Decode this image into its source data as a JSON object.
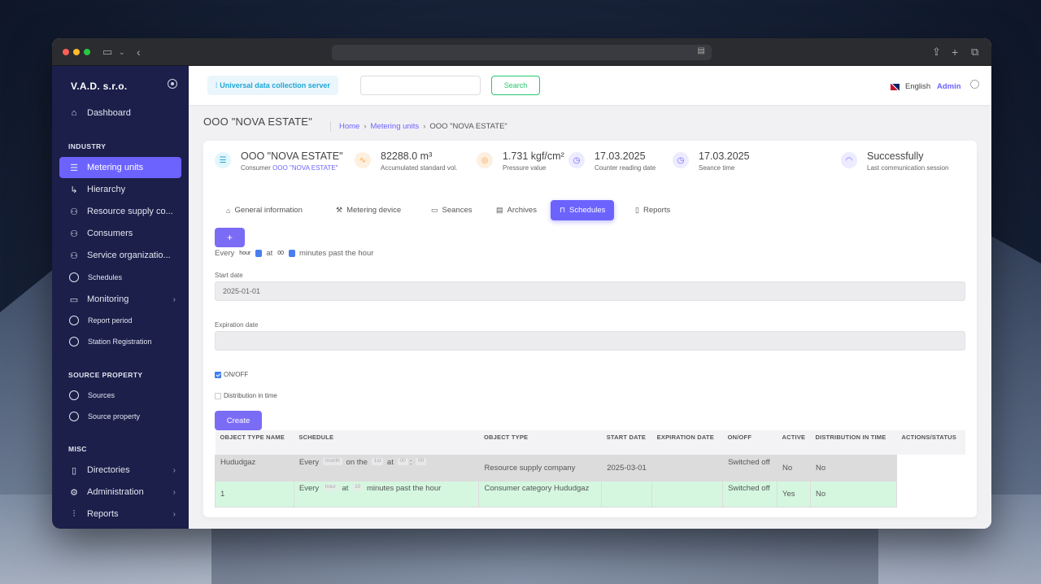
{
  "sidebar": {
    "brand": "V.A.D. s.r.o.",
    "dashboard": "Dashboard",
    "section_industry": "INDUSTRY",
    "industry_items": [
      {
        "label": "Metering units",
        "icon": "server-icon"
      },
      {
        "label": "Hierarchy",
        "icon": "corner-arrow-icon"
      },
      {
        "label": "Resource supply co...",
        "icon": "users-icon"
      },
      {
        "label": "Consumers",
        "icon": "users-icon"
      },
      {
        "label": "Service organizatio...",
        "icon": "users-icon"
      },
      {
        "label": "Schedules",
        "icon": "circle-icon"
      },
      {
        "label": "Monitoring",
        "icon": "monitor-icon"
      },
      {
        "label": "Report period",
        "icon": "circle-icon"
      },
      {
        "label": "Station Registration",
        "icon": "circle-icon"
      }
    ],
    "section_source": "SOURCE PROPERTY",
    "source_items": [
      {
        "label": "Sources"
      },
      {
        "label": "Source property"
      }
    ],
    "section_misc": "MISC",
    "misc_items": [
      {
        "label": "Directories",
        "icon": "book-icon"
      },
      {
        "label": "Administration",
        "icon": "gear-icon"
      },
      {
        "label": "Reports",
        "icon": "bar-chart-icon"
      }
    ]
  },
  "topbar": {
    "app_name": "Universal data collection server",
    "search_value": "",
    "search_button": "Search",
    "language": "English",
    "user": "Admin"
  },
  "page": {
    "title": "OOO \"NOVA ESTATE\"",
    "breadcrumb": [
      "Home",
      "Metering units",
      "OOO \"NOVA ESTATE\""
    ]
  },
  "stats": [
    {
      "value": "OOO \"NOVA ESTATE\"",
      "label": "Consumer",
      "link": "OOO \"NOVA ESTATE\""
    },
    {
      "value": "82288.0 m³",
      "label": "Accumulated standard vol."
    },
    {
      "value": "1.731 kgf/cm²",
      "label": "Pressure value"
    },
    {
      "value": "17.03.2025",
      "label": "Counter reading date"
    },
    {
      "value": "17.03.2025",
      "label": "Seance time"
    },
    {
      "value": "Successfully",
      "label": "Last communication session"
    }
  ],
  "tabs": [
    {
      "label": "General information"
    },
    {
      "label": "Metering device"
    },
    {
      "label": "Seances"
    },
    {
      "label": "Archives"
    },
    {
      "label": "Schedules"
    },
    {
      "label": "Reports"
    }
  ],
  "schedule_form": {
    "add_button": "+",
    "every_text": "Every",
    "period_value": "hour",
    "at_text": "at",
    "minute_value": "00",
    "suffix_text": "minutes past the hour",
    "start_date_label": "Start date",
    "start_date_value": "2025-01-01",
    "expiration_date_label": "Expiration date",
    "expiration_date_value": "",
    "onoff_label": "ON/OFF",
    "onoff_checked": true,
    "distribution_label": "Distribution in time",
    "distribution_checked": false,
    "create_button": "Create"
  },
  "table": {
    "headers": [
      "OBJECT TYPE NAME",
      "SCHEDULE",
      "OBJECT TYPE",
      "START DATE",
      "EXPIRATION DATE",
      "ON/OFF",
      "ACTIVE",
      "DISTRIBUTION IN TIME",
      "ACTIONS/STATUS"
    ],
    "rows": [
      {
        "name": "Hududgaz",
        "schedule": {
          "every": "Every",
          "period": "month",
          "on_the": "on the",
          "day": "1st",
          "at": "at",
          "hour": "00",
          "minute": "00"
        },
        "object_type": "Resource supply company",
        "start_date": "2025-03-01",
        "expiration_date": "",
        "onoff": "Switched off",
        "active": "No",
        "distribution": "No"
      },
      {
        "name": "1",
        "schedule": {
          "every": "Every",
          "period": "hour",
          "at": "at",
          "minute": "10",
          "suffix": "minutes past the hour"
        },
        "object_type": "Consumer category Hududgaz",
        "start_date": "",
        "expiration_date": "",
        "onoff": "Switched off",
        "active": "Yes",
        "distribution": "No"
      }
    ]
  },
  "colors": {
    "sidebar_bg": "#1b1f4a",
    "accent": "#6c63ff",
    "success": "#28c76f",
    "row_inactive": "#dcdcdc",
    "row_active": "#d5f7e0"
  }
}
